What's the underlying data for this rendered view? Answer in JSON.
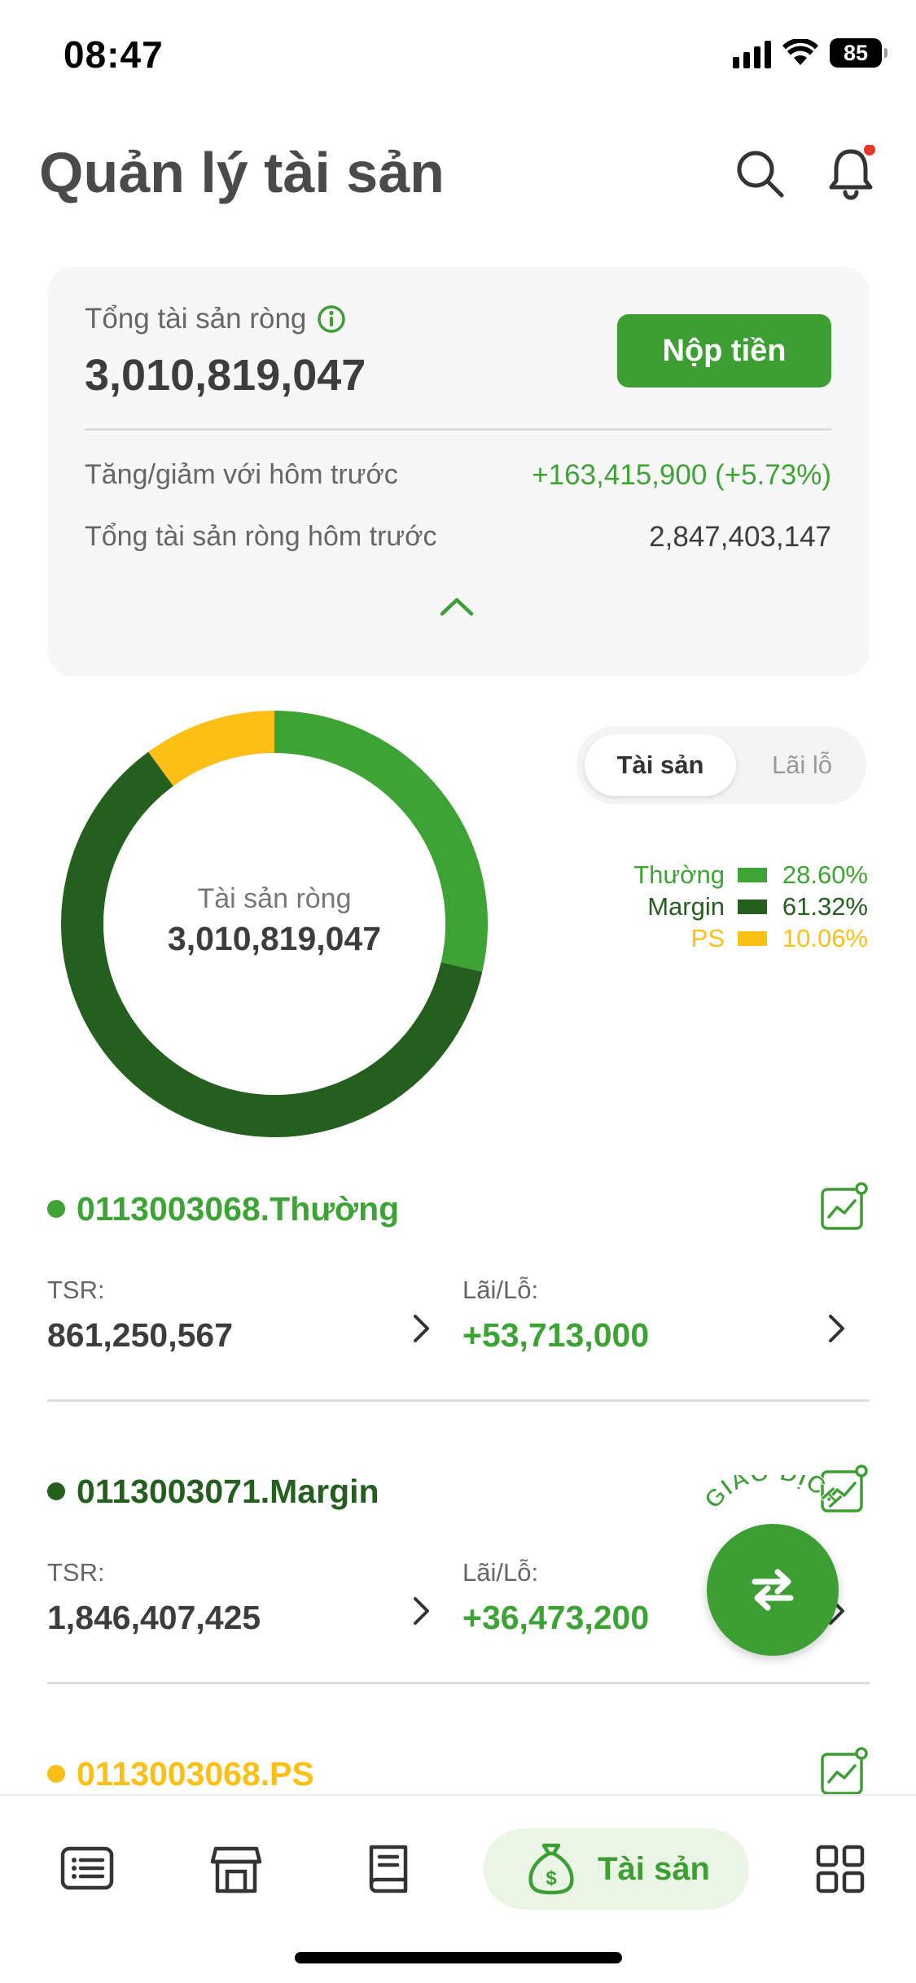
{
  "status_bar": {
    "time": "08:47",
    "battery": "85",
    "icons": [
      "signal-icon",
      "wifi-icon",
      "battery-icon"
    ]
  },
  "header": {
    "title": "Quản lý tài sản",
    "icons": [
      "search-icon",
      "bell-icon"
    ],
    "has_notification_dot": true
  },
  "summary": {
    "net_worth_label": "Tổng tài sản ròng",
    "net_worth_value": "3,010,819,047",
    "deposit_label": "Nộp tiền",
    "change_label": "Tăng/giảm với hôm trước",
    "change_value": "+163,415,900 (+5.73%)",
    "prev_label": "Tổng tài sản ròng hôm trước",
    "prev_value": "2,847,403,147"
  },
  "chart_data": {
    "type": "pie",
    "style": "donut",
    "center_label": "Tài sản ròng",
    "center_value": "3,010,819,047",
    "categories": [
      "Thường",
      "Margin",
      "PS"
    ],
    "values": [
      28.6,
      61.32,
      10.06
    ],
    "value_labels": [
      "28.60%",
      "61.32%",
      "10.06%"
    ],
    "colors": [
      "#3da334",
      "#245f1f",
      "#fbbf16"
    ],
    "legend_position": "right"
  },
  "toggle": {
    "options": [
      "Tài sản",
      "Lãi lỗ"
    ],
    "selected": "Tài sản"
  },
  "accounts": [
    {
      "name": "0113003068.Thường",
      "color": "#3da334",
      "tsr_label": "TSR:",
      "tsr_value": "861,250,567",
      "pnl_label": "Lãi/Lỗ:",
      "pnl_value": "+53,713,000"
    },
    {
      "name": "0113003071.Margin",
      "color": "#245f1f",
      "tsr_label": "TSR:",
      "tsr_value": "1,846,407,425",
      "pnl_label": "Lãi/Lỗ:",
      "pnl_value": "+36,473,200"
    },
    {
      "name": "0113003068.PS",
      "color": "#fbbf16"
    }
  ],
  "fab": {
    "caption": "GIAO DỊCH",
    "icon": "swap-arrows-icon"
  },
  "bottom_nav": {
    "items": [
      {
        "icon": "list-icon"
      },
      {
        "icon": "store-icon"
      },
      {
        "icon": "book-icon"
      },
      {
        "icon": "money-bag-icon",
        "label": "Tài sản",
        "active": true
      },
      {
        "icon": "grid-icon"
      }
    ]
  }
}
